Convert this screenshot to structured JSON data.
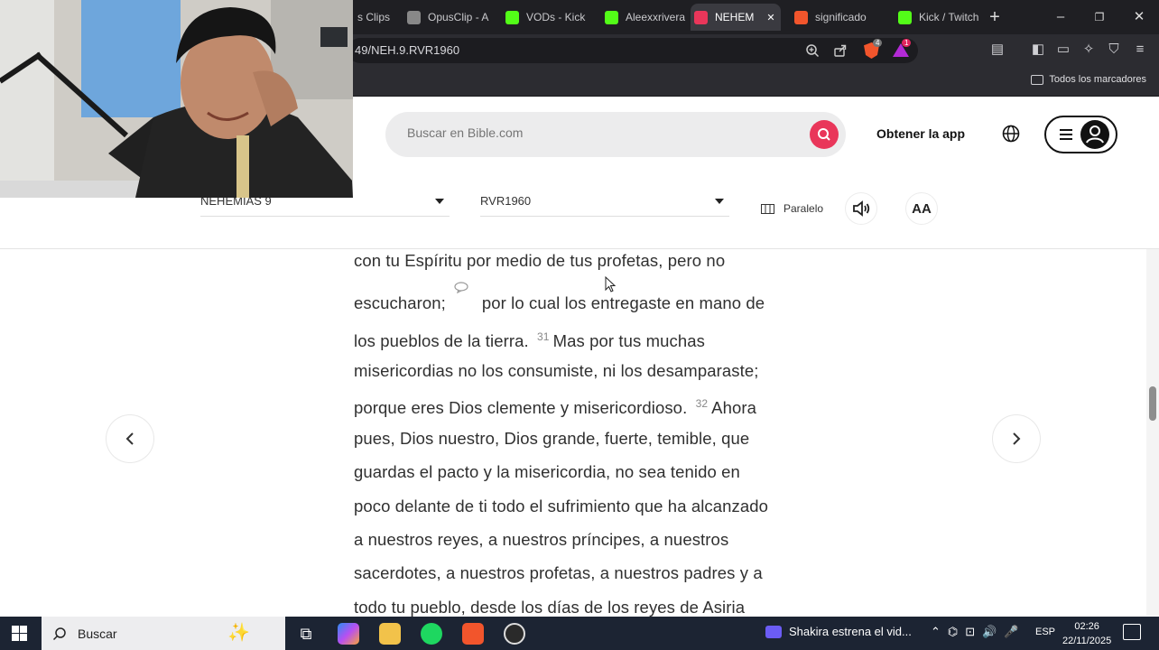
{
  "browser": {
    "tabs": [
      {
        "label": "s Clips",
        "icon": "kick-icon"
      },
      {
        "label": "OpusClip - A",
        "icon": "opusclip-icon"
      },
      {
        "label": "VODs - Kick",
        "icon": "kick-icon"
      },
      {
        "label": "Aleexxrivera",
        "icon": "kick-icon"
      },
      {
        "label": "NEHEM",
        "icon": "bible-icon",
        "active": true
      },
      {
        "label": "significado",
        "icon": "brave-search-icon"
      },
      {
        "label": "Kick / Twitch",
        "icon": "kick-icon"
      }
    ],
    "url": "49/NEH.9.RVR1960",
    "bookmarks_all": "Todos los marcadores",
    "shield_badge": "4",
    "rewards_badge": "1"
  },
  "site": {
    "search_placeholder": "Buscar en Bible.com",
    "get_app": "Obtener la app",
    "accent_color": "#e9365a"
  },
  "reader": {
    "book_chapter": "NEHEMIAS 9",
    "version": "RVR1960",
    "parallel": "Paralelo",
    "text_size_label": "AA",
    "lines": [
      {
        "text": "con tu Espíritu por medio de tus profetas, pero no"
      },
      {
        "text": "escucharon;",
        "after_note": "por lo cual los entregaste en mano de"
      },
      {
        "text": "los pueblos de la tierra.",
        "verse": "31",
        "after": "Mas por tus muchas"
      },
      {
        "text": "misericordias no los consumiste, ni los desamparaste;"
      },
      {
        "text": "porque eres Dios clemente y misericordioso.",
        "verse": "32",
        "after": "Ahora"
      },
      {
        "text": "pues, Dios nuestro, Dios grande, fuerte, temible, que"
      },
      {
        "text": "guardas el pacto y la misericordia, no sea tenido en"
      },
      {
        "text": "poco delante de ti todo el sufrimiento que ha alcanzado"
      },
      {
        "text": "a nuestros reyes, a nuestros príncipes, a nuestros"
      },
      {
        "text": "sacerdotes, a nuestros profetas, a nuestros padres y a"
      },
      {
        "text": "todo tu pueblo, desde los días de los reyes de Asiria"
      }
    ]
  },
  "taskbar": {
    "search_label": "Buscar",
    "news": "Shakira estrena el vid...",
    "lang": "ESP",
    "time": "02:26",
    "date": "22/11/2025"
  }
}
